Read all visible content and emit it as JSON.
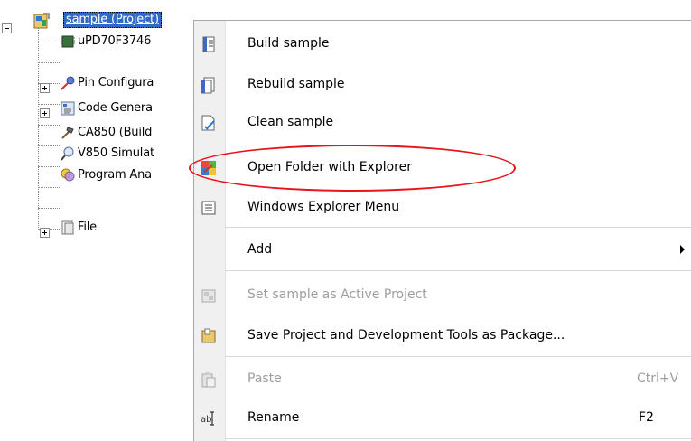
{
  "tree": {
    "root": {
      "label": "sample (Project)"
    },
    "children": [
      {
        "label": "uPD70F3746",
        "icon": "chip-icon"
      },
      {
        "label": "Pin Configura",
        "icon": "pin-configurator-icon"
      },
      {
        "label": "Code Genera",
        "icon": "code-generator-icon"
      },
      {
        "label": "CA850 (Build",
        "icon": "build-tool-icon"
      },
      {
        "label": "V850 Simulat",
        "icon": "simulator-icon"
      },
      {
        "label": "Program Ana",
        "icon": "program-analyzer-icon"
      },
      {
        "label": "File",
        "icon": "file-folder-icon"
      }
    ]
  },
  "menu": {
    "items": [
      {
        "label": "Build sample",
        "icon": "build-icon"
      },
      {
        "label": "Rebuild sample",
        "icon": "rebuild-icon"
      },
      {
        "label": "Clean sample",
        "icon": "clean-icon"
      },
      {
        "label": "Open Folder with Explorer",
        "icon": "open-folder-icon"
      },
      {
        "label": "Windows Explorer Menu",
        "icon": "explorer-menu-icon"
      },
      {
        "label": "Add",
        "icon": ""
      },
      {
        "label": "Set sample as Active Project",
        "icon": "active-project-icon"
      },
      {
        "label": "Save Project and Development Tools as Package...",
        "icon": "package-icon"
      },
      {
        "label": "Paste",
        "icon": "paste-icon",
        "shortcut": "Ctrl+V"
      },
      {
        "label": "Rename",
        "icon": "rename-icon",
        "shortcut": "F2"
      }
    ]
  },
  "colors": {
    "selection": "#316ac5",
    "highlight_ellipse": "#e8141b",
    "disabled_text": "#9e9e9e"
  }
}
